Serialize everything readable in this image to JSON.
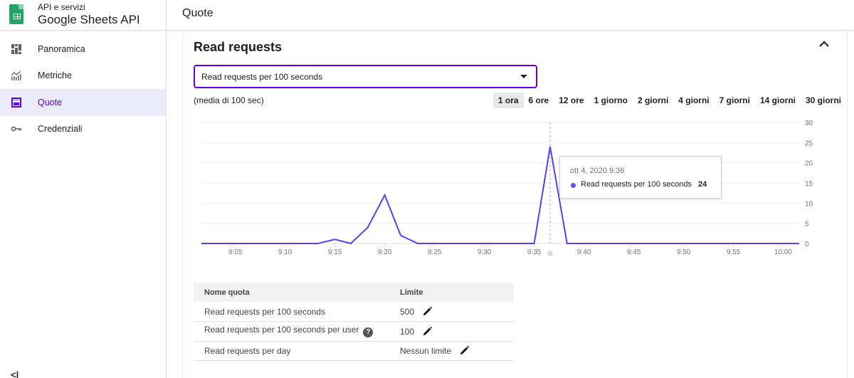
{
  "sidebar": {
    "supertitle": "API e servizi",
    "title": "Google Sheets API",
    "items": [
      {
        "label": "Panoramica",
        "icon": "dashboard-icon",
        "active": false
      },
      {
        "label": "Metriche",
        "icon": "metrics-chart-icon",
        "active": false
      },
      {
        "label": "Quote",
        "icon": "quota-icon",
        "active": true
      },
      {
        "label": "Credenziali",
        "icon": "key-icon",
        "active": false
      }
    ],
    "collapse_label": "<|"
  },
  "header": {
    "title": "Quote"
  },
  "card": {
    "title": "Read requests",
    "select": {
      "value": "Read requests per 100 seconds"
    },
    "avg_label": "(media di 100 sec)",
    "ranges": [
      {
        "label": "1 ora",
        "active": true
      },
      {
        "label": "6 ore",
        "active": false
      },
      {
        "label": "12 ore",
        "active": false
      },
      {
        "label": "1 giorno",
        "active": false
      },
      {
        "label": "2 giorni",
        "active": false
      },
      {
        "label": "4 giorni",
        "active": false
      },
      {
        "label": "7 giorni",
        "active": false
      },
      {
        "label": "14 giorni",
        "active": false
      },
      {
        "label": "30 giorni",
        "active": false
      }
    ]
  },
  "tooltip": {
    "date": "ott 4, 2020 9:36",
    "series": "Read requests per 100 seconds",
    "value": "24"
  },
  "colors": {
    "accent": "#6200ee",
    "series": "#5c3ef0",
    "active_bg": "#ecebfa"
  },
  "chart_data": {
    "type": "line",
    "title": "Read requests per 100 seconds",
    "xlabel": "",
    "ylabel": "",
    "x_ticks": [
      "9:05",
      "9:10",
      "9:15",
      "9:20",
      "9:25",
      "9:30",
      "9:35",
      "9:40",
      "9:45",
      "9:50",
      "9:55",
      "10:00"
    ],
    "y_ticks": [
      0,
      5,
      10,
      15,
      20,
      25,
      30
    ],
    "ylim": [
      0,
      30
    ],
    "xlim_minutes": [
      1.6,
      61.6
    ],
    "grid": true,
    "legend": "none",
    "hover_minute": 36.6,
    "series": [
      {
        "name": "Read requests per 100 seconds",
        "x_minutes_after_9": [
          1.6,
          13.3,
          15.0,
          16.6,
          18.3,
          20.0,
          21.6,
          23.3,
          35.0,
          36.6,
          38.3,
          61.6
        ],
        "values": [
          0,
          0,
          1,
          0,
          4,
          12,
          2,
          0,
          0,
          24,
          0,
          0
        ]
      }
    ]
  },
  "quota_table": {
    "headers": [
      "Nome quota",
      "Limite"
    ],
    "rows": [
      {
        "name": "Read requests per 100 seconds",
        "limit": "500",
        "help": false
      },
      {
        "name": "Read requests per 100 seconds per user",
        "limit": "100",
        "help": true
      },
      {
        "name": "Read requests per day",
        "limit": "Nessun limite",
        "help": false
      }
    ]
  }
}
